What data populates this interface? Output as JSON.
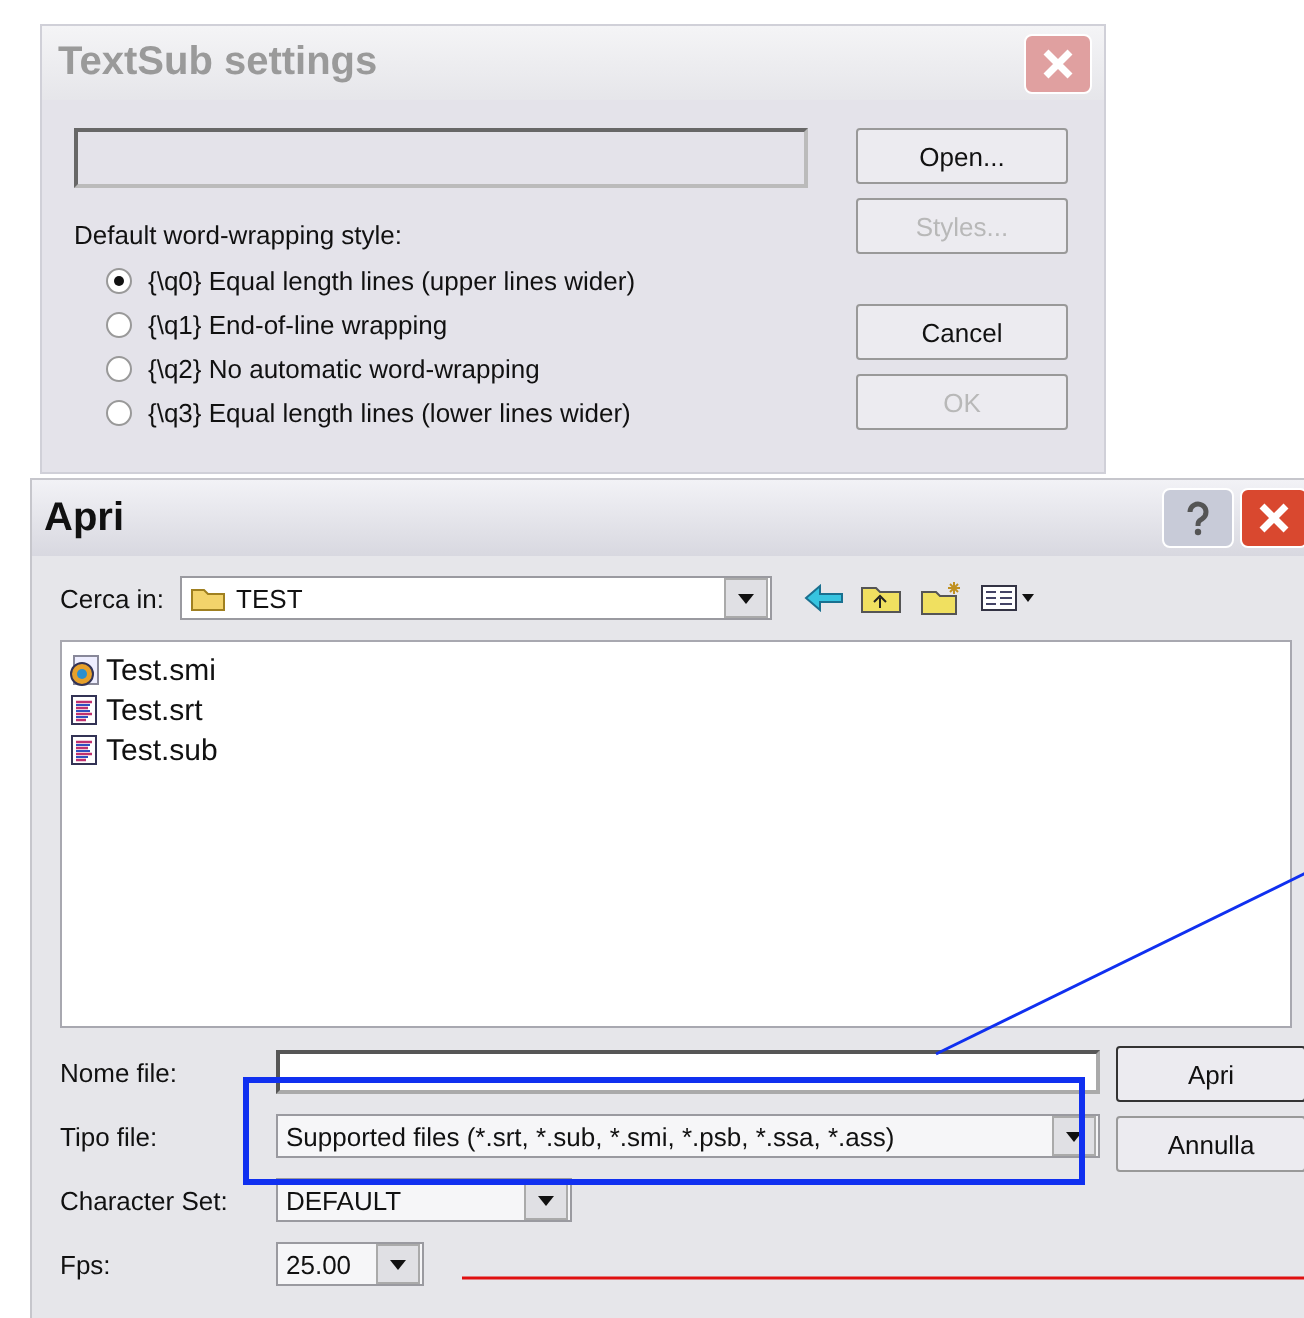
{
  "settings": {
    "title": "TextSub settings",
    "wrap_label": "Default word-wrapping style:",
    "options": [
      {
        "label": "{\\q0} Equal length lines (upper lines wider)",
        "selected": true
      },
      {
        "label": "{\\q1} End-of-line wrapping",
        "selected": false
      },
      {
        "label": "{\\q2} No automatic word-wrapping",
        "selected": false
      },
      {
        "label": "{\\q3} Equal length lines (lower lines wider)",
        "selected": false
      }
    ],
    "buttons": [
      {
        "label": "Open...",
        "disabled": false
      },
      {
        "label": "Styles...",
        "disabled": true
      },
      {
        "label": "Cancel",
        "disabled": false
      },
      {
        "label": "OK",
        "disabled": true
      }
    ]
  },
  "open_dialog": {
    "title": "Apri",
    "look_in": {
      "label": "Cerca in:",
      "value": "TEST"
    },
    "files": [
      {
        "name": "Test.smi",
        "kind": "media"
      },
      {
        "name": "Test.srt",
        "kind": "text"
      },
      {
        "name": "Test.sub",
        "kind": "text"
      }
    ],
    "fields": [
      {
        "label": "Nome file:",
        "kind": "text"
      },
      {
        "label": "Tipo file:",
        "kind": "combo",
        "value": "Supported files (*.srt, *.sub, *.smi, *.psb, *.ssa, *.ass)"
      },
      {
        "label": "Character Set:",
        "kind": "combo",
        "value": "DEFAULT"
      },
      {
        "label": "Fps:",
        "kind": "combo",
        "value": "25.00"
      }
    ],
    "buttons": [
      {
        "label": "Apri",
        "default": true
      },
      {
        "label": "Annulla",
        "default": false
      }
    ]
  }
}
